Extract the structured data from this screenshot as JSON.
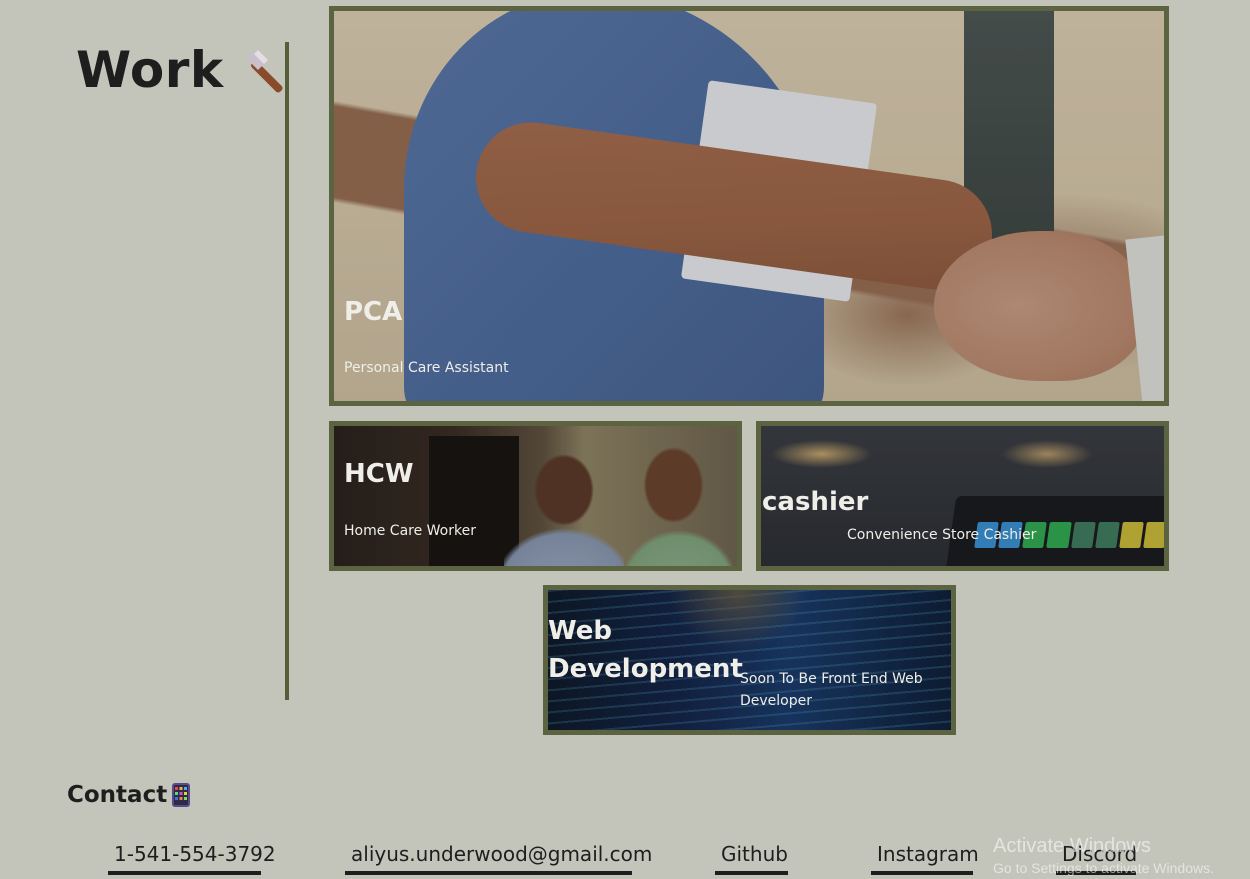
{
  "work": {
    "title": "Work",
    "icon": "hammer-icon"
  },
  "cards": {
    "pca": {
      "title": "PCA",
      "subtitle": "Personal Care Assistant"
    },
    "hcw": {
      "title": "HCW",
      "subtitle": "Home Care Worker"
    },
    "cashier": {
      "title": "cashier",
      "subtitle": "Convenience Store Cashier"
    },
    "webdev": {
      "title_line1": "Web",
      "title_line2": "Development",
      "subtitle": "Soon To Be Front End Web Developer"
    }
  },
  "contact": {
    "title": "Contact",
    "icon": "phone-icon",
    "phone": "1-541-554-3792",
    "email": "aliyus.underwood@gmail.com",
    "github": "Github",
    "instagram": "Instagram",
    "discord": "Discord"
  },
  "watermark": {
    "line1": "Activate Windows",
    "line2": "Go to Settings to activate Windows."
  },
  "colors": {
    "background": "#c4c5ba",
    "accent": "#5b6340",
    "text": "#1e1e1e"
  }
}
